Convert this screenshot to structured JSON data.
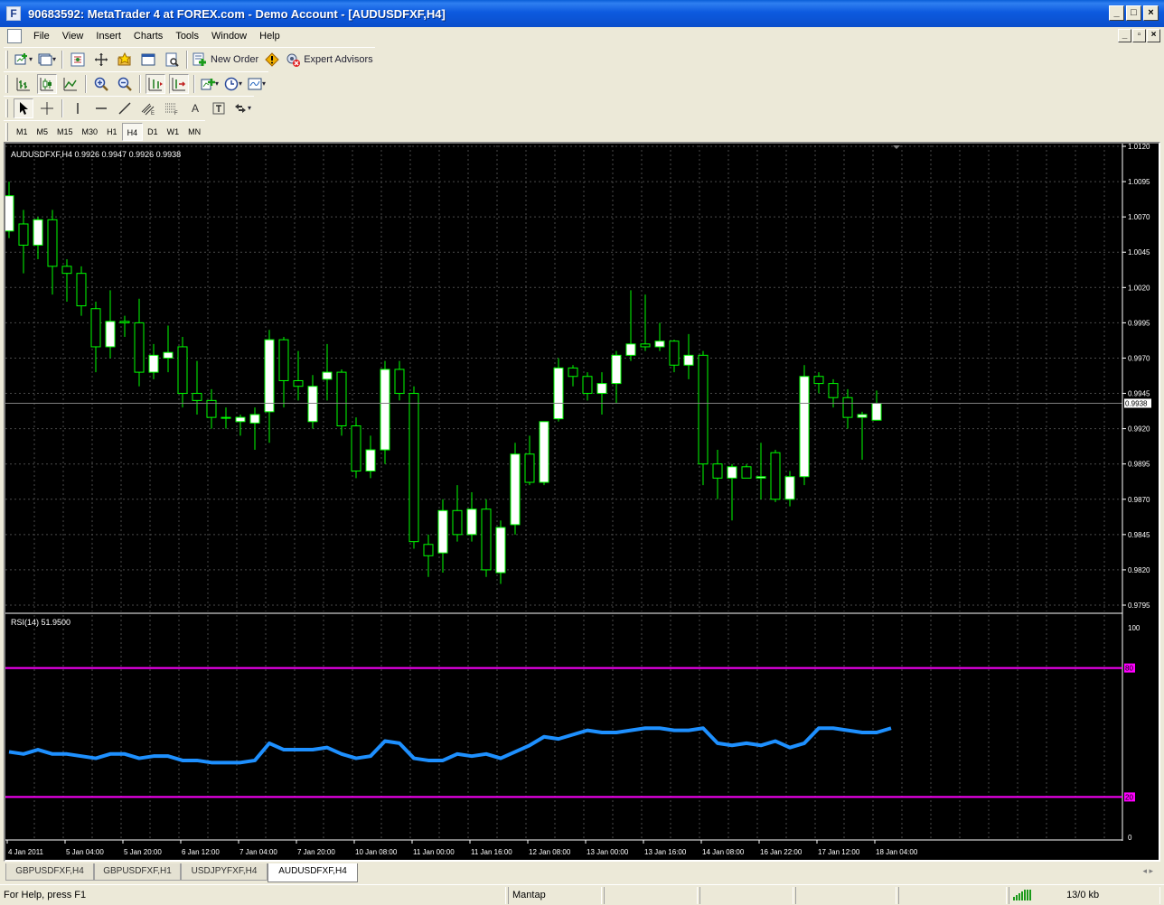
{
  "window": {
    "title": "90683592: MetaTrader 4 at FOREX.com - Demo Account - [AUDUSDFXF,H4]",
    "app_icon_letter": "F"
  },
  "menu": [
    "File",
    "View",
    "Insert",
    "Charts",
    "Tools",
    "Window",
    "Help"
  ],
  "toolbar": {
    "new_order_label": "New Order",
    "expert_advisors_label": "Expert Advisors"
  },
  "timeframes": [
    "M1",
    "M5",
    "M15",
    "M30",
    "H1",
    "H4",
    "D1",
    "W1",
    "MN"
  ],
  "active_timeframe": "H4",
  "chart": {
    "header": "AUDUSDFXF,H4  0.9926 0.9947 0.9926 0.9938",
    "current_price_label": "0.9938",
    "price_ticks": [
      "1.0120",
      "1.0095",
      "1.0070",
      "1.0045",
      "1.0020",
      "0.9995",
      "0.9970",
      "0.9945",
      "0.9920",
      "0.9895",
      "0.9870",
      "0.9845",
      "0.9820",
      "0.9795"
    ],
    "time_ticks": [
      "4 Jan 2011",
      "5 Jan 04:00",
      "5 Jan 20:00",
      "6 Jan 12:00",
      "7 Jan 04:00",
      "7 Jan 20:00",
      "10 Jan 08:00",
      "11 Jan 00:00",
      "11 Jan 16:00",
      "12 Jan 08:00",
      "13 Jan 00:00",
      "13 Jan 16:00",
      "14 Jan 08:00",
      "16 Jan 22:00",
      "17 Jan 12:00",
      "18 Jan 04:00"
    ],
    "rsi_header": "RSI(14) 51.9500",
    "rsi_ticks": [
      "100",
      "80",
      "20",
      "0"
    ],
    "colors": {
      "background": "#000000",
      "bull_candle": "#ffffff",
      "bear_candle": "#000000",
      "wick": "#00ff00",
      "grid": "#4a4a4a",
      "rsi_line": "#1e90ff",
      "rsi_levels": "#ff00ff",
      "axis_text": "#ffffff"
    }
  },
  "chart_data": {
    "type": "candlestick",
    "symbol": "AUDUSDFXF",
    "timeframe": "H4",
    "ylim": [
      0.979,
      1.012
    ],
    "candles": [
      {
        "o": 1.006,
        "h": 1.0095,
        "l": 1.0055,
        "c": 1.0085
      },
      {
        "o": 1.0065,
        "h": 1.0075,
        "l": 1.003,
        "c": 1.005
      },
      {
        "o": 1.005,
        "h": 1.007,
        "l": 1.004,
        "c": 1.0068
      },
      {
        "o": 1.0068,
        "h": 1.0075,
        "l": 1.0015,
        "c": 1.0035
      },
      {
        "o": 1.0035,
        "h": 1.004,
        "l": 1.001,
        "c": 1.003
      },
      {
        "o": 1.003,
        "h": 1.0035,
        "l": 1.0,
        "c": 1.0007
      },
      {
        "o": 1.0005,
        "h": 1.001,
        "l": 0.996,
        "c": 0.9978
      },
      {
        "o": 0.9978,
        "h": 1.0018,
        "l": 0.997,
        "c": 0.9996
      },
      {
        "o": 0.9996,
        "h": 1.0,
        "l": 0.9985,
        "c": 0.9995
      },
      {
        "o": 0.9995,
        "h": 1.0012,
        "l": 0.995,
        "c": 0.996
      },
      {
        "o": 0.996,
        "h": 0.998,
        "l": 0.9955,
        "c": 0.9972
      },
      {
        "o": 0.997,
        "h": 0.9993,
        "l": 0.996,
        "c": 0.9974
      },
      {
        "o": 0.9978,
        "h": 0.9985,
        "l": 0.9935,
        "c": 0.9945
      },
      {
        "o": 0.9945,
        "h": 0.9968,
        "l": 0.993,
        "c": 0.994
      },
      {
        "o": 0.994,
        "h": 0.9948,
        "l": 0.992,
        "c": 0.9928
      },
      {
        "o": 0.9928,
        "h": 0.9935,
        "l": 0.992,
        "c": 0.9928
      },
      {
        "o": 0.9925,
        "h": 0.993,
        "l": 0.9915,
        "c": 0.9928
      },
      {
        "o": 0.9924,
        "h": 0.9935,
        "l": 0.9905,
        "c": 0.993
      },
      {
        "o": 0.9932,
        "h": 0.999,
        "l": 0.991,
        "c": 0.9983
      },
      {
        "o": 0.9983,
        "h": 0.9985,
        "l": 0.9935,
        "c": 0.9954
      },
      {
        "o": 0.9954,
        "h": 0.9975,
        "l": 0.994,
        "c": 0.995
      },
      {
        "o": 0.9925,
        "h": 0.9958,
        "l": 0.992,
        "c": 0.995
      },
      {
        "o": 0.9955,
        "h": 0.998,
        "l": 0.994,
        "c": 0.996
      },
      {
        "o": 0.996,
        "h": 0.9962,
        "l": 0.9915,
        "c": 0.9922
      },
      {
        "o": 0.9922,
        "h": 0.9928,
        "l": 0.9885,
        "c": 0.989
      },
      {
        "o": 0.989,
        "h": 0.9915,
        "l": 0.9885,
        "c": 0.9905
      },
      {
        "o": 0.9905,
        "h": 0.9968,
        "l": 0.9895,
        "c": 0.9962
      },
      {
        "o": 0.9962,
        "h": 0.9968,
        "l": 0.994,
        "c": 0.9945
      },
      {
        "o": 0.9945,
        "h": 0.995,
        "l": 0.9835,
        "c": 0.984
      },
      {
        "o": 0.9838,
        "h": 0.9845,
        "l": 0.9815,
        "c": 0.983
      },
      {
        "o": 0.9832,
        "h": 0.987,
        "l": 0.9818,
        "c": 0.9862
      },
      {
        "o": 0.9862,
        "h": 0.988,
        "l": 0.984,
        "c": 0.9845
      },
      {
        "o": 0.9845,
        "h": 0.9875,
        "l": 0.984,
        "c": 0.9863
      },
      {
        "o": 0.9863,
        "h": 0.987,
        "l": 0.9815,
        "c": 0.982
      },
      {
        "o": 0.9818,
        "h": 0.9855,
        "l": 0.981,
        "c": 0.985
      },
      {
        "o": 0.9852,
        "h": 0.991,
        "l": 0.9845,
        "c": 0.9902
      },
      {
        "o": 0.9902,
        "h": 0.9915,
        "l": 0.988,
        "c": 0.9882
      },
      {
        "o": 0.9882,
        "h": 0.9925,
        "l": 0.988,
        "c": 0.9925
      },
      {
        "o": 0.9927,
        "h": 0.997,
        "l": 0.9925,
        "c": 0.9963
      },
      {
        "o": 0.9963,
        "h": 0.9965,
        "l": 0.995,
        "c": 0.9957
      },
      {
        "o": 0.9957,
        "h": 0.996,
        "l": 0.994,
        "c": 0.9945
      },
      {
        "o": 0.9945,
        "h": 0.996,
        "l": 0.993,
        "c": 0.9952
      },
      {
        "o": 0.9952,
        "h": 0.9975,
        "l": 0.9938,
        "c": 0.9972
      },
      {
        "o": 0.9972,
        "h": 1.0018,
        "l": 0.9968,
        "c": 0.998
      },
      {
        "o": 0.998,
        "h": 1.0015,
        "l": 0.9975,
        "c": 0.9978
      },
      {
        "o": 0.9978,
        "h": 0.9995,
        "l": 0.9975,
        "c": 0.9982
      },
      {
        "o": 0.9982,
        "h": 0.9983,
        "l": 0.996,
        "c": 0.9965
      },
      {
        "o": 0.9965,
        "h": 0.9987,
        "l": 0.9955,
        "c": 0.9972
      },
      {
        "o": 0.9972,
        "h": 0.9975,
        "l": 0.988,
        "c": 0.9895
      },
      {
        "o": 0.9895,
        "h": 0.9905,
        "l": 0.987,
        "c": 0.9885
      },
      {
        "o": 0.9885,
        "h": 0.9895,
        "l": 0.9855,
        "c": 0.9893
      },
      {
        "o": 0.9893,
        "h": 0.9895,
        "l": 0.9885,
        "c": 0.9885
      },
      {
        "o": 0.9885,
        "h": 0.991,
        "l": 0.987,
        "c": 0.9886
      },
      {
        "o": 0.9903,
        "h": 0.9905,
        "l": 0.9868,
        "c": 0.987
      },
      {
        "o": 0.987,
        "h": 0.989,
        "l": 0.9865,
        "c": 0.9886
      },
      {
        "o": 0.9886,
        "h": 0.9965,
        "l": 0.988,
        "c": 0.9957
      },
      {
        "o": 0.9957,
        "h": 0.996,
        "l": 0.9945,
        "c": 0.9952
      },
      {
        "o": 0.9952,
        "h": 0.9955,
        "l": 0.9935,
        "c": 0.9942
      },
      {
        "o": 0.9942,
        "h": 0.9948,
        "l": 0.992,
        "c": 0.9928
      },
      {
        "o": 0.9928,
        "h": 0.9932,
        "l": 0.9898,
        "c": 0.993
      },
      {
        "o": 0.9926,
        "h": 0.9947,
        "l": 0.9926,
        "c": 0.9938
      }
    ],
    "rsi": [
      41,
      40,
      42,
      40,
      40,
      39,
      38,
      40,
      40,
      38,
      39,
      39,
      37,
      37,
      36,
      36,
      36,
      37,
      45,
      42,
      42,
      42,
      43,
      40,
      38,
      39,
      46,
      45,
      38,
      37,
      37,
      40,
      39,
      40,
      38,
      41,
      44,
      48,
      47,
      49,
      51,
      50,
      50,
      51,
      52,
      52,
      51,
      51,
      52,
      45,
      44,
      45,
      44,
      46,
      43,
      45,
      52,
      52,
      51,
      50,
      50,
      52
    ],
    "rsi_levels": [
      80,
      20
    ],
    "rsi_ylim": [
      0,
      100
    ]
  },
  "chart_tabs": [
    "GBPUSDFXF,H4",
    "GBPUSDFXF,H1",
    "USDJPYFXF,H4",
    "AUDUSDFXF,H4"
  ],
  "active_chart_tab": "AUDUSDFXF,H4",
  "status": {
    "help": "For Help, press F1",
    "profile": "Mantap",
    "traffic": "13/0 kb"
  }
}
